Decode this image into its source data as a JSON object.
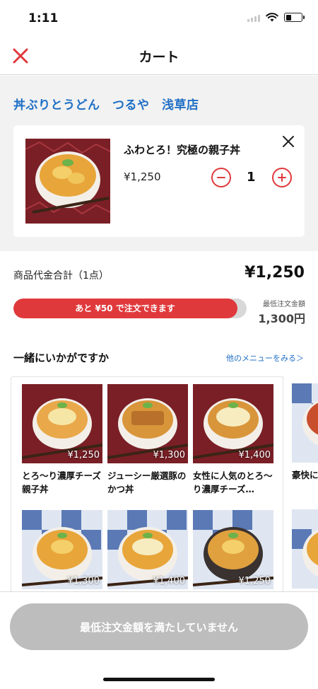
{
  "status_bar": {
    "time": "1:11"
  },
  "nav": {
    "title": "カート"
  },
  "shop": {
    "name": "丼ぶりとうどん　つるや　浅草店"
  },
  "cart_item": {
    "name": "ふわとろ！究極の親子丼",
    "price": "¥1,250",
    "quantity": "1"
  },
  "summary": {
    "subtotal_label": "商品代金合計（1点）",
    "subtotal_value": "¥1,250",
    "progress_text": "あと ¥50 で注文できます",
    "progress_fraction": 0.96,
    "min_label": "最低注文金額",
    "min_value": "1,300円"
  },
  "suggestions": {
    "title": "一緒にいかがですか",
    "link": "他のメニューをみる＞",
    "items": [
      {
        "name": "とろ〜り濃厚チーズ親子丼",
        "price": "¥1,250"
      },
      {
        "name": "ジューシー厳選豚のかつ丼",
        "price": "¥1,300"
      },
      {
        "name": "女性に人気のとろ〜り濃厚チーズ…",
        "price": "¥1,400"
      },
      {
        "name": "豪快にっぷり",
        "price": ""
      },
      {
        "name": "",
        "price": "¥1,300"
      },
      {
        "name": "",
        "price": "¥1,400"
      },
      {
        "name": "",
        "price": "¥1,250"
      }
    ]
  },
  "checkout": {
    "label": "最低注文金額を満たしていません"
  },
  "colors": {
    "accent_red": "#e0393c",
    "link_blue": "#1f6fc5",
    "disabled_gray": "#bdbdbd"
  }
}
